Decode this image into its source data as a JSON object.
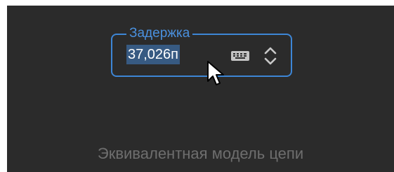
{
  "delay_field": {
    "label": "Задержка",
    "value": "37,026п",
    "accent_color": "#3d86d6",
    "keyboard_icon": "keyboard-icon",
    "stepper_icon": "up-down-chevron-icon"
  },
  "footer": {
    "label": "Эквивалентная модель цепи"
  },
  "theme": {
    "background": "#2b2b2b",
    "selection": "#375a82",
    "muted_text": "#6e6e6e"
  }
}
